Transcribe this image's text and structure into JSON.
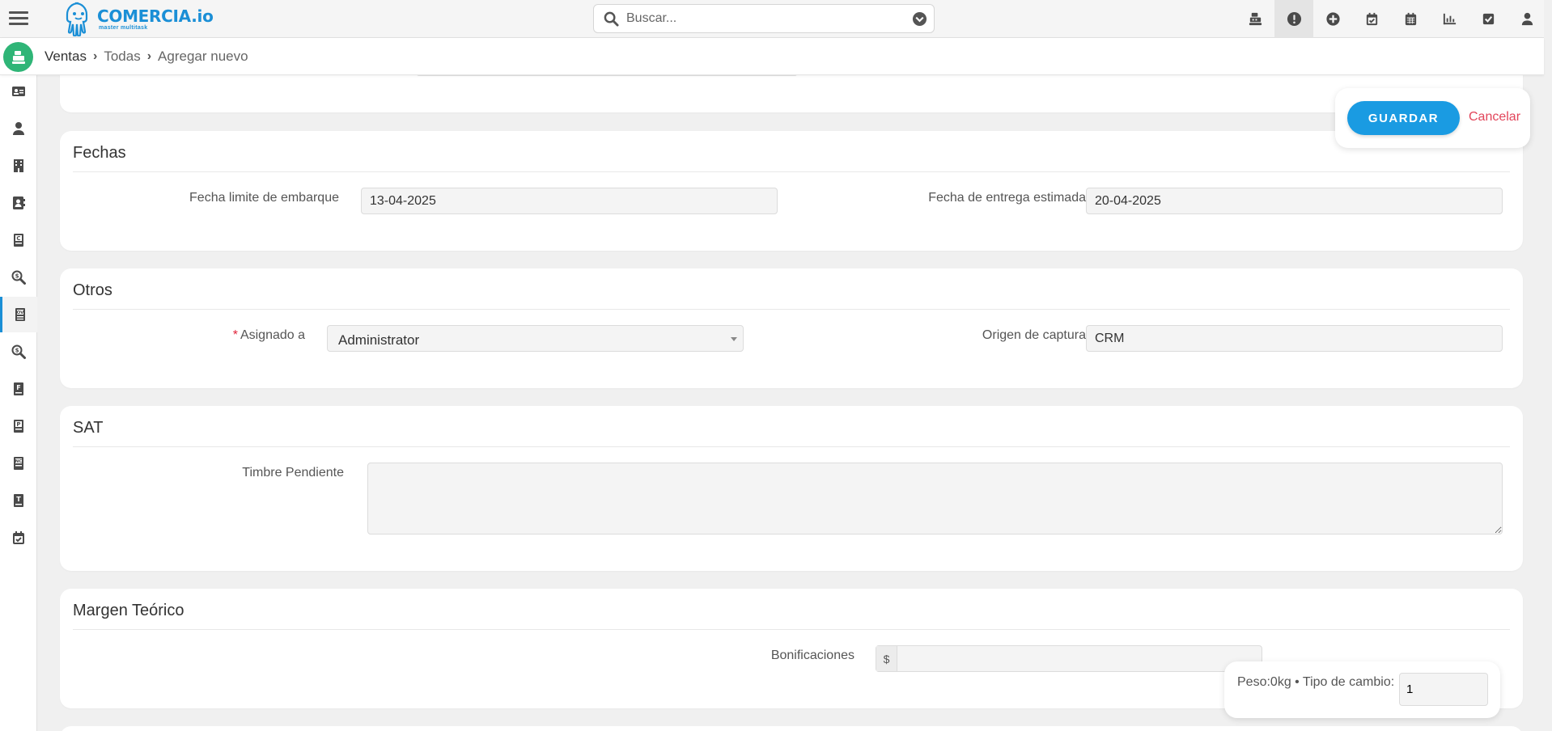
{
  "app": {
    "logo_name": "COMERCIA.io",
    "logo_tagline": "master multitask"
  },
  "search": {
    "placeholder": "Buscar..."
  },
  "header_icons": [
    "cash-register-icon",
    "alert-icon",
    "add-icon",
    "calendar-check-icon",
    "calendar-icon",
    "chart-icon",
    "checkbox-icon",
    "user-icon"
  ],
  "breadcrumb": {
    "module": "Ventas",
    "level1": "Todas",
    "level2": "Agregar nuevo"
  },
  "sidebar": [
    "contact-card-icon",
    "person-icon",
    "building-icon",
    "contacts-icon",
    "document-c-icon",
    "search-dollar-icon",
    "sales-order-icon",
    "search-money-icon",
    "invoice-icon",
    "document-p-icon",
    "credit-note-icon",
    "document-t-icon",
    "calendar-check-icon"
  ],
  "actions": {
    "save": "GUARDAR",
    "cancel": "Cancelar"
  },
  "fechas": {
    "title": "Fechas",
    "limite_label": "Fecha limite de embarque",
    "limite_value": "13-04-2025",
    "entrega_label": "Fecha de entrega estimada",
    "entrega_value": "20-04-2025"
  },
  "otros": {
    "title": "Otros",
    "required_mark": "*",
    "asignado_label": "Asignado a",
    "asignado_value": "Administrator",
    "origen_label": "Origen de captura",
    "origen_value": "CRM"
  },
  "sat": {
    "title": "SAT",
    "timbre_label": "Timbre Pendiente",
    "timbre_value": ""
  },
  "margen": {
    "title": "Margen Teórico",
    "bonificaciones_label": "Bonificaciones",
    "currency": "$",
    "bonificaciones_value": ""
  },
  "footer": {
    "peso_text": "Peso:0kg • Tipo de cambio:",
    "tipo_cambio": "1"
  },
  "colors": {
    "accent": "#1a9be2",
    "brand_green": "#2fb577",
    "cancel": "#e2455a"
  }
}
